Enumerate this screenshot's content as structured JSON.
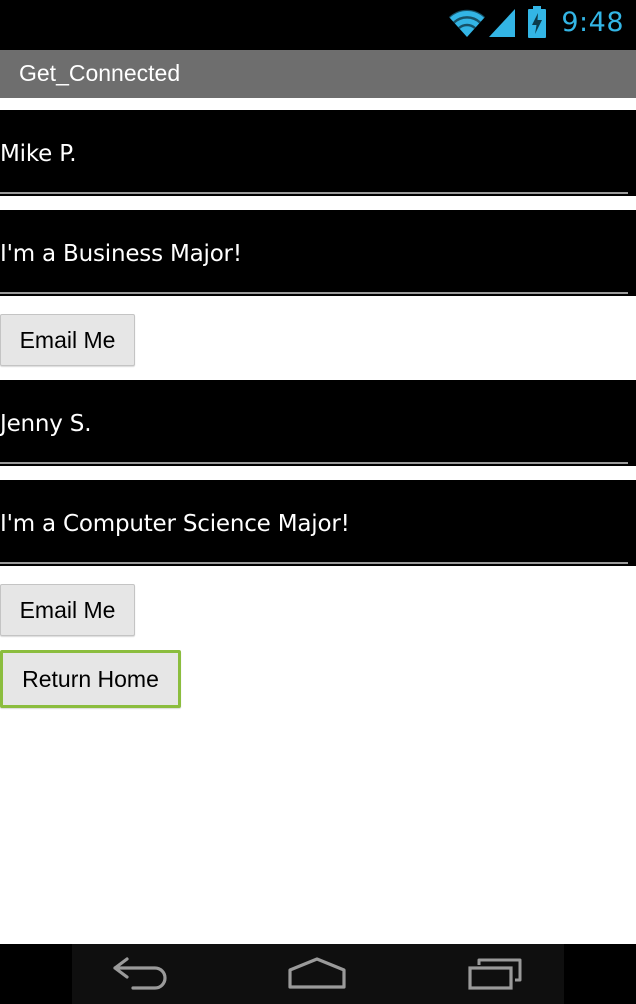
{
  "status_bar": {
    "time": "9:48",
    "icons": [
      "wifi-icon",
      "cell-signal-icon",
      "battery-charging-icon"
    ],
    "accent_color": "#33b5e5"
  },
  "app": {
    "title": "Get_Connected",
    "title_bar_color": "#6e6e6e"
  },
  "profiles": [
    {
      "name": "Mike P.",
      "major": "I'm a Business Major!",
      "email_label": "Email Me"
    },
    {
      "name": "Jenny S.",
      "major": "I'm a Computer Science Major!",
      "email_label": "Email Me"
    }
  ],
  "return_home_label": "Return Home",
  "focus_color": "#8bbd3e",
  "nav_bar": {
    "buttons": [
      "back-icon",
      "home-icon",
      "recent-apps-icon"
    ]
  }
}
